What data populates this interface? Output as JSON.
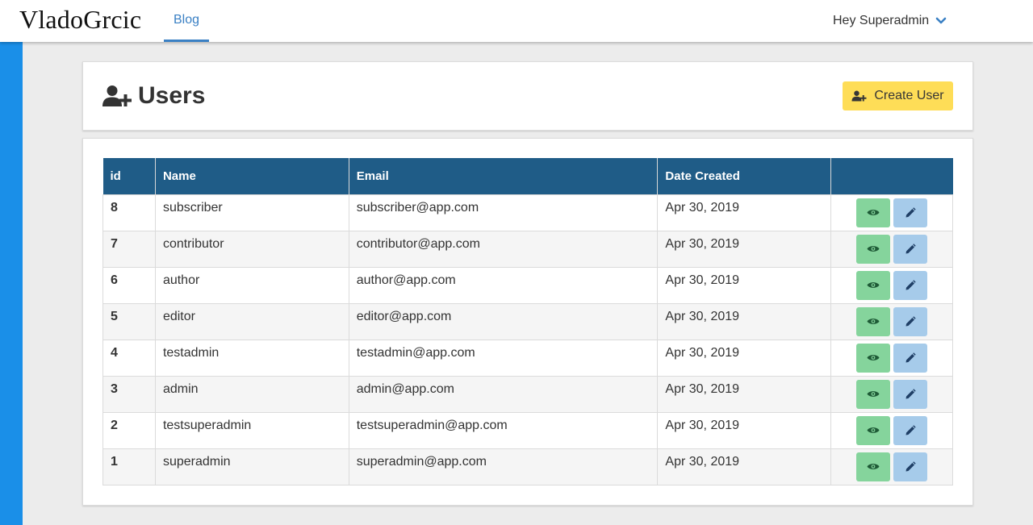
{
  "navbar": {
    "brand": "VladoGrcic",
    "tabs": [
      {
        "label": "Blog",
        "active": true
      }
    ],
    "user_greeting": "Hey Superadmin",
    "user_menu_icon": "chevron-down-icon"
  },
  "colors": {
    "accent": "#3a80c4",
    "side_strip": "#1a8fe8",
    "table_header": "#1f5c87",
    "create_button": "#fedd57",
    "view_button": "#85d49c",
    "edit_button": "#a6cbea"
  },
  "page": {
    "title": "Users",
    "title_icon": "user-plus-icon",
    "create_button_label": "Create User",
    "create_button_icon": "user-plus-icon"
  },
  "table": {
    "columns": [
      "id",
      "Name",
      "Email",
      "Date Created",
      ""
    ],
    "rows": [
      {
        "id": "8",
        "name": "subscriber",
        "email": "subscriber@app.com",
        "date": "Apr 30, 2019"
      },
      {
        "id": "7",
        "name": "contributor",
        "email": "contributor@app.com",
        "date": "Apr 30, 2019"
      },
      {
        "id": "6",
        "name": "author",
        "email": "author@app.com",
        "date": "Apr 30, 2019"
      },
      {
        "id": "5",
        "name": "editor",
        "email": "editor@app.com",
        "date": "Apr 30, 2019"
      },
      {
        "id": "4",
        "name": "testadmin",
        "email": "testadmin@app.com",
        "date": "Apr 30, 2019"
      },
      {
        "id": "3",
        "name": "admin",
        "email": "admin@app.com",
        "date": "Apr 30, 2019"
      },
      {
        "id": "2",
        "name": "testsuperadmin",
        "email": "testsuperadmin@app.com",
        "date": "Apr 30, 2019"
      },
      {
        "id": "1",
        "name": "superadmin",
        "email": "superadmin@app.com",
        "date": "Apr 30, 2019"
      }
    ],
    "row_actions": [
      {
        "icon": "eye-icon",
        "action": "view"
      },
      {
        "icon": "pencil-icon",
        "action": "edit"
      }
    ]
  }
}
